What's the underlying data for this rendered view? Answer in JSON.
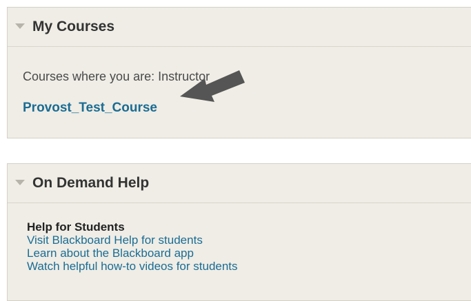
{
  "my_courses": {
    "title": "My Courses",
    "role_text": "Courses where you are: Instructor",
    "courses": [
      {
        "label": "Provost_Test_Course"
      }
    ]
  },
  "on_demand_help": {
    "title": "On Demand Help",
    "heading": "Help for Students",
    "links": [
      {
        "label": "Visit Blackboard Help for students"
      },
      {
        "label": "Learn about the Blackboard app"
      },
      {
        "label": "Watch helpful how-to videos for students"
      }
    ]
  },
  "icons": {
    "collapse_toggle": "triangle-down-icon",
    "pointer_annotation": "arrow-left-icon"
  },
  "colors": {
    "link": "#1b6c93",
    "module_bg": "#efede6",
    "arrow": "#555555"
  }
}
